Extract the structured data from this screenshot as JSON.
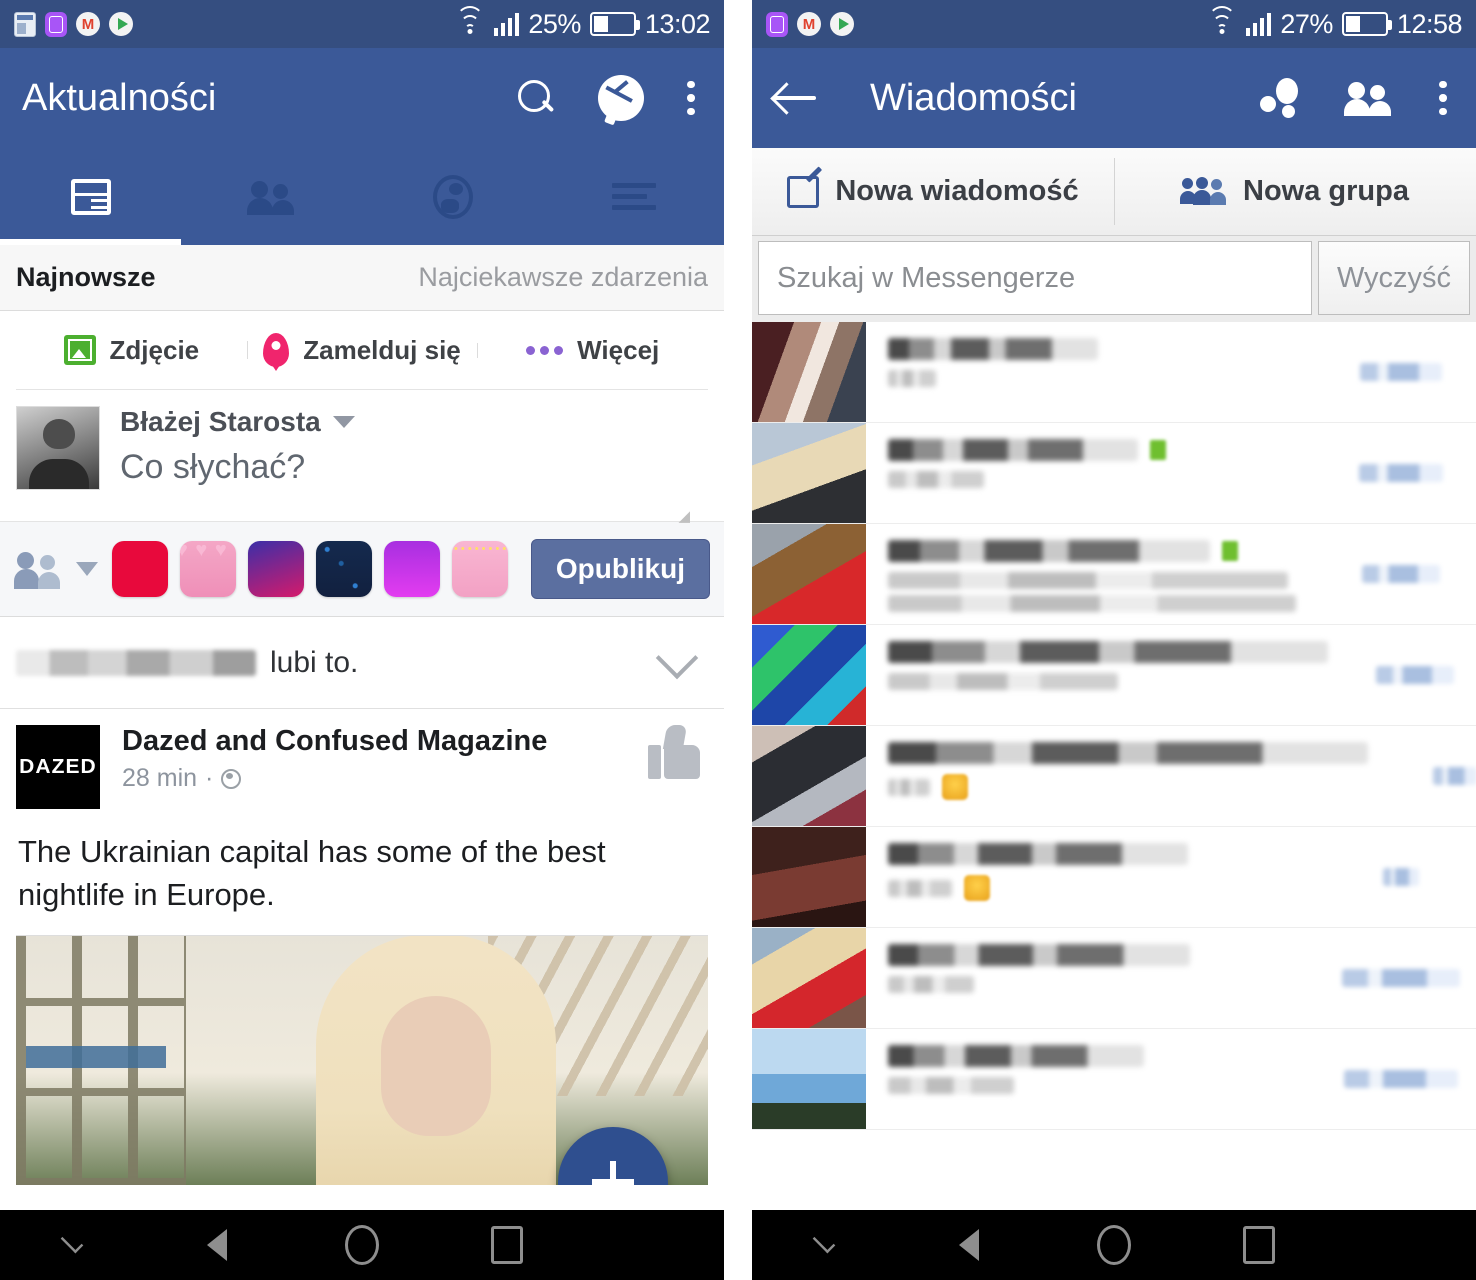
{
  "left": {
    "status_bar": {
      "battery_percent": "25%",
      "clock": "13:02",
      "icons": [
        "news-app-icon",
        "gallery-app-icon",
        "gmail-icon",
        "play-store-icon",
        "wifi-icon",
        "signal-icon",
        "battery-icon"
      ],
      "gmail_glyph": "M"
    },
    "header": {
      "title": "Aktualności",
      "actions": [
        "search-icon",
        "messenger-icon",
        "overflow-menu-icon"
      ]
    },
    "tabs": [
      {
        "name": "news-feed",
        "icon": "feed-icon",
        "active": true
      },
      {
        "name": "friends",
        "icon": "people-icon",
        "active": false
      },
      {
        "name": "notifications",
        "icon": "globe-icon",
        "active": false
      },
      {
        "name": "menu",
        "icon": "hamburger-icon",
        "active": false
      }
    ],
    "sort_row": {
      "primary": "Najnowsze",
      "secondary": "Najciekawsze zdarzenia"
    },
    "composer": {
      "actions": [
        {
          "label": "Zdjęcie",
          "icon": "photo-icon"
        },
        {
          "label": "Zamelduj się",
          "icon": "location-pin-icon"
        },
        {
          "label": "Więcej",
          "icon": "more-dots-icon"
        }
      ],
      "author": "Błażej Starosta",
      "placeholder": "Co słychać?",
      "publish_label": "Opublikuj",
      "swatch_colors": [
        "#e8093c",
        "#f092bb",
        "#7b2fbe",
        "#12203f",
        "#c21cf0",
        "#f6a7c8"
      ]
    },
    "story": {
      "blurred_name": true,
      "suffix": "lubi to."
    },
    "post": {
      "page_logo_text": "DAZED",
      "page_name": "Dazed and Confused Magazine",
      "time": "28 min",
      "privacy_icon": "globe-icon",
      "reaction_icon": "thumbs-up-icon",
      "body": "The Ukrainian capital has some of the best nightlife in Europe.",
      "photo_alt": "blonde-woman-photo"
    },
    "fab": {
      "icon": "plus-icon"
    }
  },
  "right": {
    "status_bar": {
      "battery_percent": "27%",
      "clock": "12:58",
      "icons": [
        "gallery-app-icon",
        "gmail-icon",
        "play-store-icon",
        "wifi-icon",
        "signal-icon",
        "battery-icon"
      ],
      "gmail_glyph": "M"
    },
    "header": {
      "back_icon": "back-arrow-icon",
      "title": "Wiadomości",
      "actions": [
        "messenger-active-icon",
        "new-group-people-icon",
        "overflow-menu-icon"
      ]
    },
    "tabs": [
      {
        "label": "Nowa wiadomość",
        "icon": "compose-icon"
      },
      {
        "label": "Nowa grupa",
        "icon": "group-icon"
      }
    ],
    "search": {
      "placeholder": "Szukaj w Messengerze",
      "value": "",
      "clear_label": "Wyczyść"
    },
    "conversations": [
      {
        "avatar": "av1",
        "name_blurred": true,
        "snippet_blurred": true,
        "snippet_lines": 1,
        "online": false,
        "emoji": false,
        "time_blurred": true
      },
      {
        "avatar": "av2",
        "name_blurred": true,
        "snippet_blurred": true,
        "snippet_lines": 1,
        "online": true,
        "emoji": false,
        "time_blurred": true
      },
      {
        "avatar": "av3",
        "name_blurred": true,
        "snippet_blurred": true,
        "snippet_lines": 2,
        "online": true,
        "emoji": false,
        "time_blurred": true
      },
      {
        "avatar": "av4",
        "name_blurred": true,
        "snippet_blurred": true,
        "snippet_lines": 1,
        "online": false,
        "emoji": false,
        "time_blurred": true
      },
      {
        "avatar": "av5",
        "name_blurred": true,
        "snippet_blurred": true,
        "snippet_lines": 1,
        "online": false,
        "emoji": true,
        "time_blurred": true
      },
      {
        "avatar": "av6",
        "name_blurred": true,
        "snippet_blurred": true,
        "snippet_lines": 1,
        "online": false,
        "emoji": true,
        "time_blurred": true
      },
      {
        "avatar": "av7",
        "name_blurred": true,
        "snippet_blurred": true,
        "snippet_lines": 1,
        "online": false,
        "emoji": false,
        "time_blurred": true
      },
      {
        "avatar": "av8",
        "name_blurred": true,
        "snippet_blurred": true,
        "snippet_lines": 1,
        "online": false,
        "emoji": false,
        "time_blurred": true
      }
    ]
  },
  "navbar": {
    "buttons": [
      {
        "name": "hide-nav-button",
        "icon": "chevron-down-icon"
      },
      {
        "name": "back-button",
        "icon": "triangle-back-icon"
      },
      {
        "name": "home-button",
        "icon": "circle-home-icon"
      },
      {
        "name": "recents-button",
        "icon": "square-recents-icon"
      }
    ]
  },
  "colors": {
    "facebook_blue": "#3B5998",
    "status_bar_blue": "#354E80",
    "accent_green": "#4caf2f",
    "accent_pink": "#f0256d",
    "fab_blue": "#2f4f8f"
  }
}
